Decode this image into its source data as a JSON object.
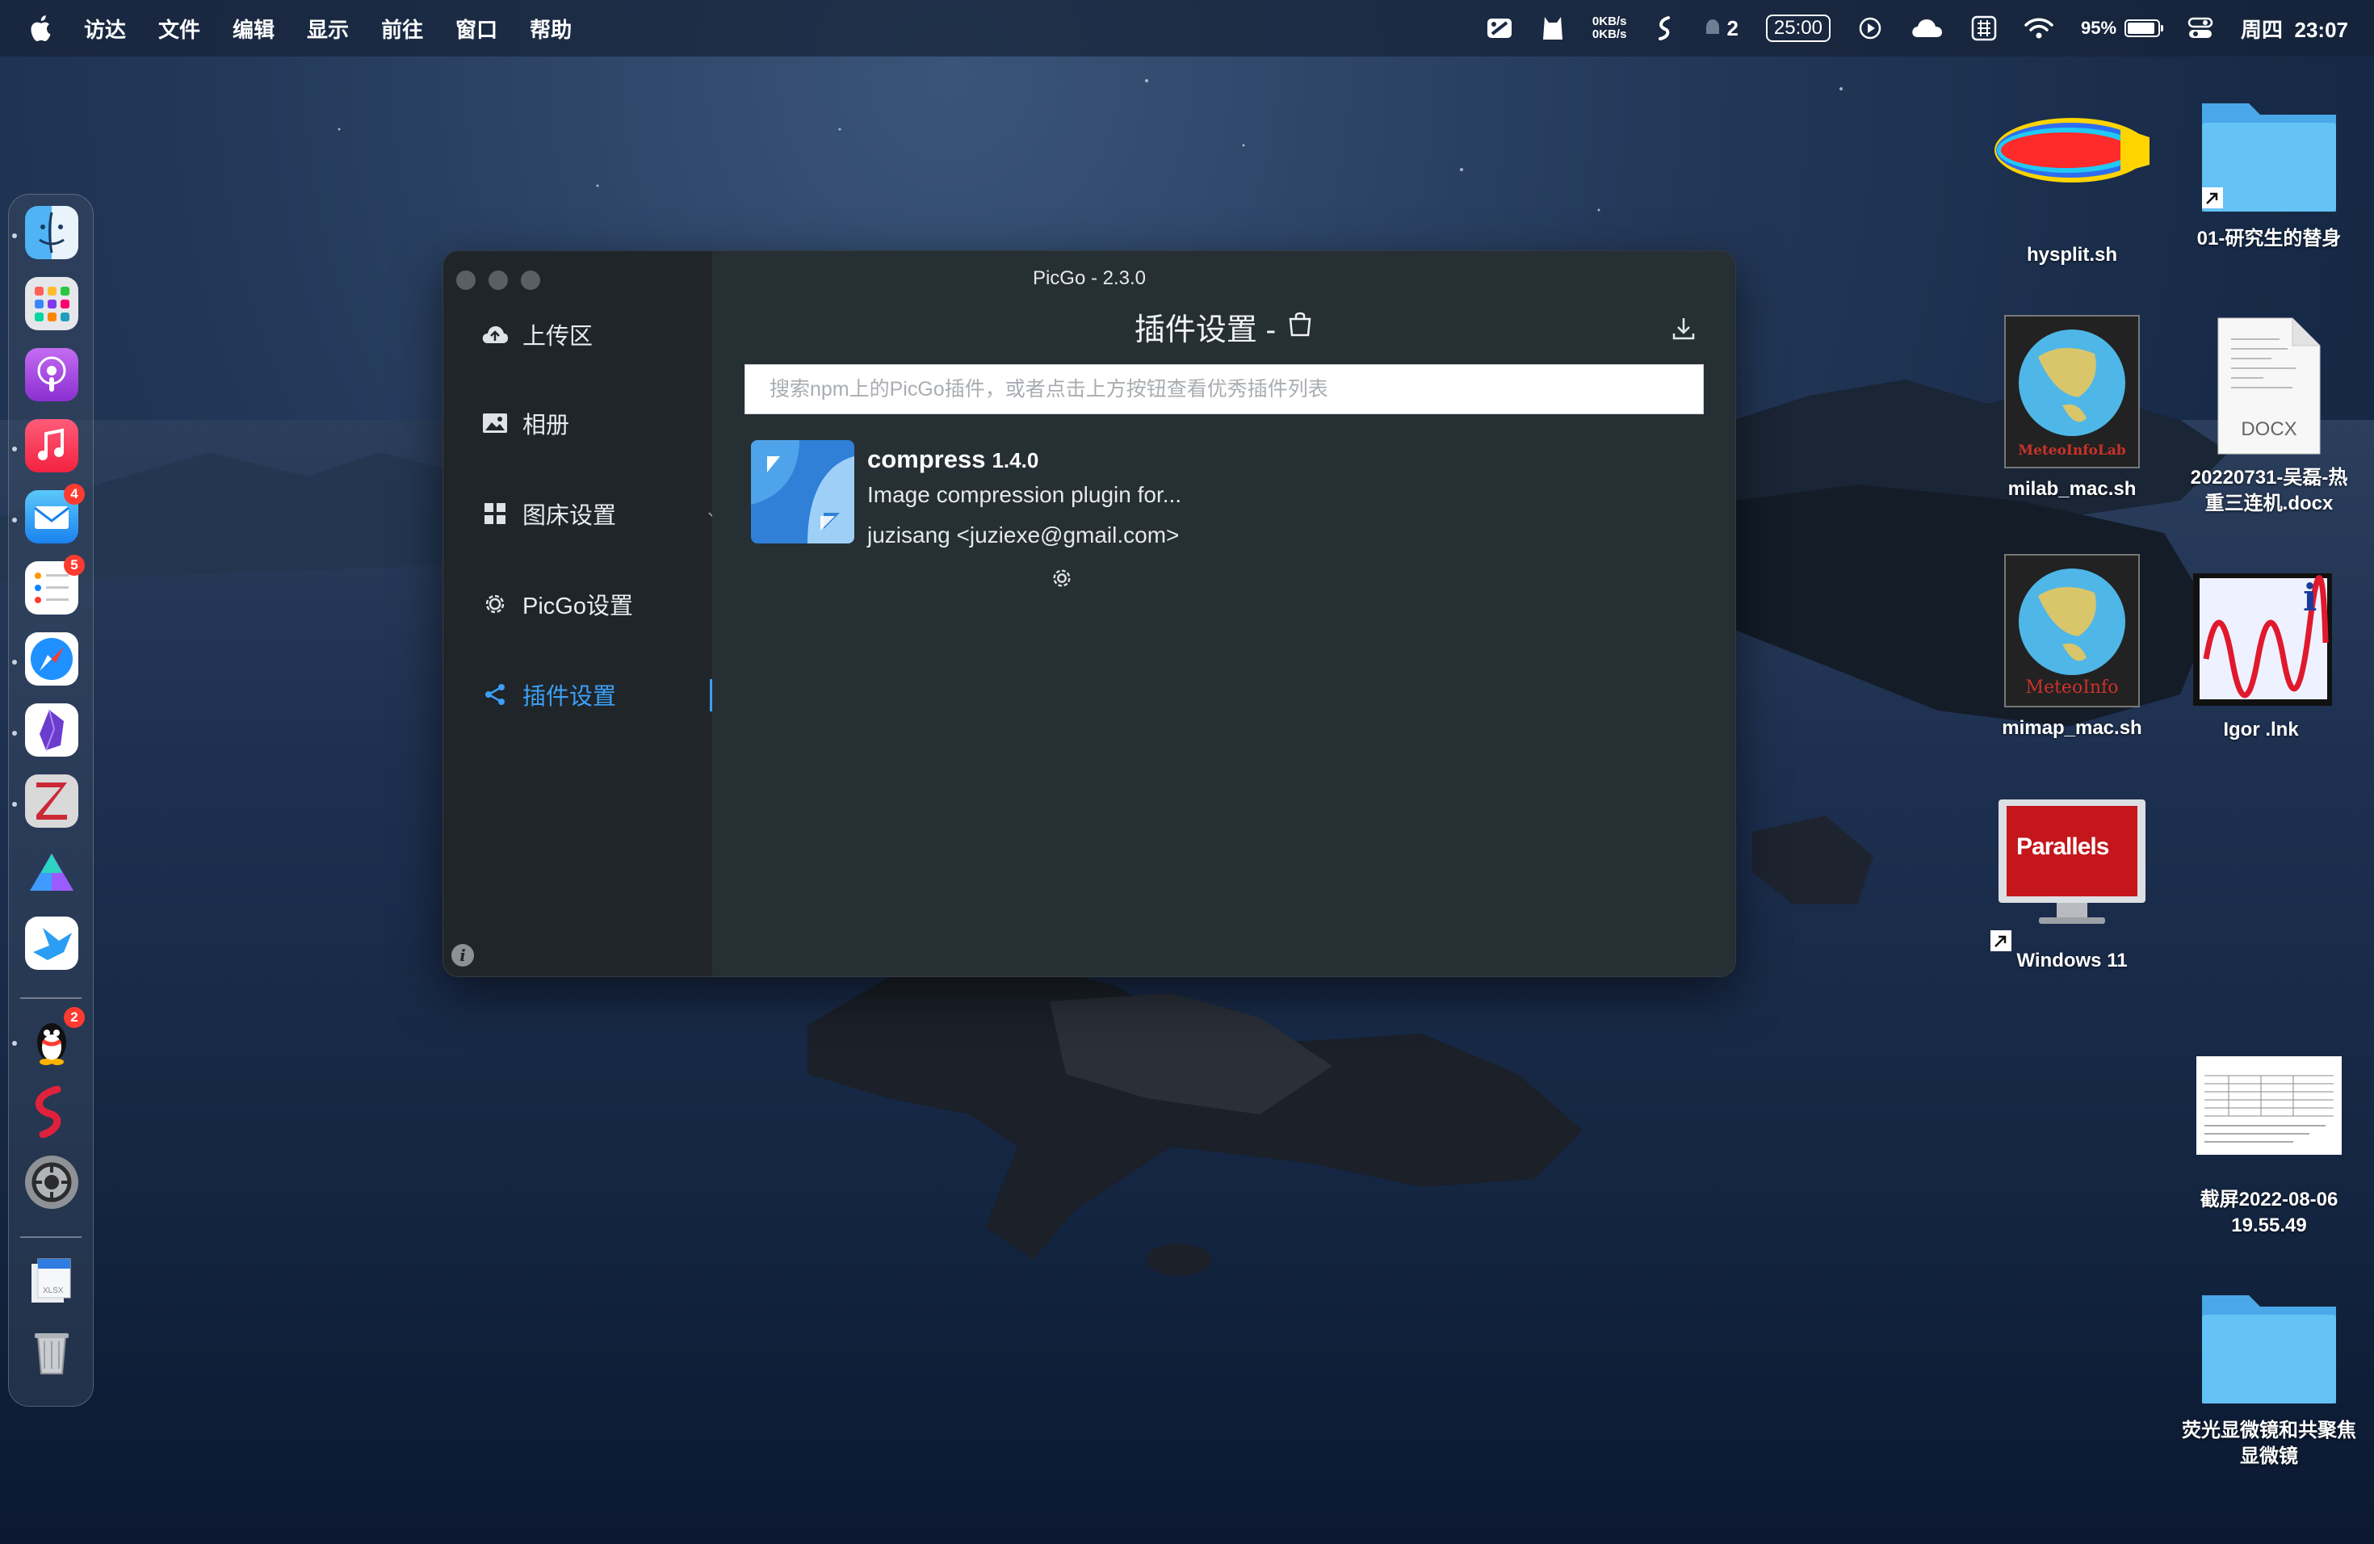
{
  "menubar": {
    "app_menus": [
      "访达",
      "文件",
      "编辑",
      "显示",
      "前往",
      "窗口",
      "帮助"
    ],
    "net_up": "0KB/s",
    "net_down": "0KB/s",
    "notif_count": "2",
    "timer": "25:00",
    "battery": "95%",
    "day": "周四",
    "time": "23:07"
  },
  "dock": {
    "items": [
      {
        "name": "finder",
        "badge": ""
      },
      {
        "name": "launchpad",
        "badge": ""
      },
      {
        "name": "podcasts",
        "badge": ""
      },
      {
        "name": "music",
        "badge": ""
      },
      {
        "name": "mail",
        "badge": "4"
      },
      {
        "name": "reminders",
        "badge": "5"
      },
      {
        "name": "safari",
        "badge": ""
      },
      {
        "name": "obsidian",
        "badge": ""
      },
      {
        "name": "zotero",
        "badge": ""
      },
      {
        "name": "prism",
        "badge": ""
      },
      {
        "name": "xcode-like",
        "badge": ""
      },
      {
        "name": "qq",
        "badge": "2"
      },
      {
        "name": "scrobbler",
        "badge": ""
      },
      {
        "name": "system-preferences",
        "badge": ""
      },
      {
        "name": "documents-stack",
        "badge": ""
      },
      {
        "name": "trash",
        "badge": ""
      }
    ],
    "stack_label": "XLSX"
  },
  "window": {
    "title": "PicGo - 2.3.0",
    "sidebar": [
      {
        "label": "上传区",
        "icon": "cloud-upload-icon"
      },
      {
        "label": "相册",
        "icon": "image-icon"
      },
      {
        "label": "图床设置",
        "icon": "grid-icon"
      },
      {
        "label": "PicGo设置",
        "icon": "gear-icon"
      },
      {
        "label": "插件设置",
        "icon": "share-icon"
      }
    ],
    "info_glyph": "i",
    "heading": "插件设置 -",
    "search_placeholder": "搜索npm上的PicGo插件，或者点击上方按钮查看优秀插件列表",
    "plugin": {
      "name": "compress",
      "version": "1.4.0",
      "description": "Image compression plugin for...",
      "author": "juzisang <juziexe@gmail.com>"
    }
  },
  "desktop": {
    "icons": [
      {
        "label": "hysplit.sh"
      },
      {
        "label": "01-研究生的替身"
      },
      {
        "label": "milab_mac.sh",
        "art_text": "MeteoInfoLab"
      },
      {
        "label": "20220731-吴磊-热重三连机.docx",
        "label_line1": "20220731-吴磊-热",
        "label_line2": "重三连机.docx",
        "art_text": "DOCX"
      },
      {
        "label": "mimap_mac.sh",
        "art_text": "MeteoInfo"
      },
      {
        "label": "Igor .lnk"
      },
      {
        "label": "Windows 11",
        "art_text": "Parallels"
      },
      {
        "label": "截屏2022-08-06 19.55.49",
        "label_line1": "截屏2022-08-06",
        "label_line2": "19.55.49"
      },
      {
        "label": "荧光显微镜和共聚焦显微镜",
        "label_line1": "荧光显微镜和共聚焦",
        "label_line2": "显微镜"
      }
    ]
  },
  "colors": {
    "accent": "#3d9ff5",
    "sidebar_bg": "#1f2529",
    "main_bg": "#262f33",
    "folder_blue": "#5bbcf2"
  }
}
